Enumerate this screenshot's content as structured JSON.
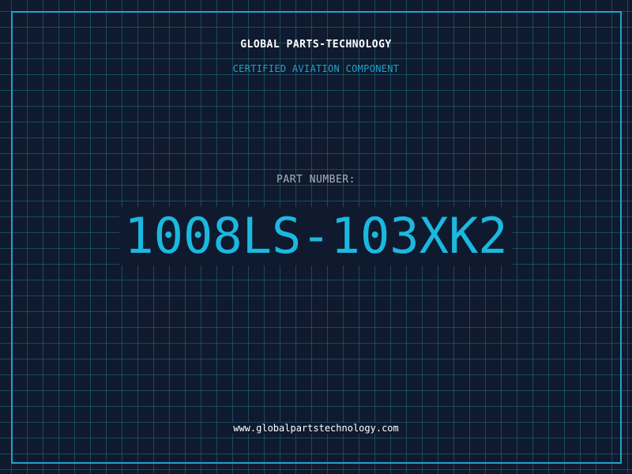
{
  "header": {
    "company_name": "GLOBAL PARTS-TECHNOLOGY",
    "subtitle": "CERTIFIED AVIATION COMPONENT"
  },
  "part": {
    "label": "PART NUMBER:",
    "number": "1008LS-103XK2"
  },
  "footer": {
    "website": "www.globalpartstechnology.com"
  },
  "colors": {
    "background": "#0f1a2e",
    "accent": "#1fa3c9",
    "part_number": "#1bb8e0",
    "label": "#a8b3c2",
    "text": "#ffffff"
  }
}
